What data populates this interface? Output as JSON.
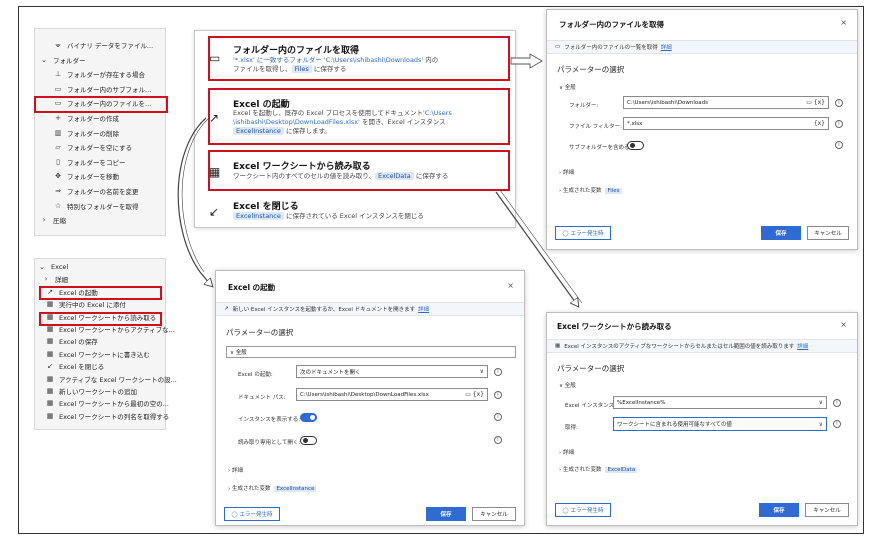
{
  "sidebar_top": {
    "items": [
      {
        "icon": "binary-icon",
        "glyph": "⩖",
        "label": "バイナリ データをファイル..."
      },
      {
        "icon": "chevron-down-icon",
        "glyph": "⌄",
        "label": "フォルダー"
      },
      {
        "icon": "folder-exists-icon",
        "glyph": "⊥",
        "label": "フォルダーが存在する場合"
      },
      {
        "icon": "subfolder-icon",
        "glyph": "▭",
        "label": "フォルダー内のサブフォル..."
      },
      {
        "icon": "folder-files-icon",
        "glyph": "▭",
        "label": "フォルダー内のファイルを..."
      },
      {
        "icon": "plus-icon",
        "glyph": "+",
        "label": "フォルダーの作成"
      },
      {
        "icon": "trash-icon",
        "glyph": "▥",
        "label": "フォルダーの削除"
      },
      {
        "icon": "folder-empty-icon",
        "glyph": "▱",
        "label": "フォルダーを空にする"
      },
      {
        "icon": "copy-icon",
        "glyph": "▯",
        "label": "フォルダーをコピー"
      },
      {
        "icon": "move-icon",
        "glyph": "✥",
        "label": "フォルダーを移動"
      },
      {
        "icon": "rename-icon",
        "glyph": "⇒",
        "label": "フォルダーの名前を変更"
      },
      {
        "icon": "star-icon",
        "glyph": "☆",
        "label": "特別なフォルダーを取得"
      },
      {
        "icon": "chevron-right-icon",
        "glyph": "›",
        "label": "圧縮"
      }
    ]
  },
  "sidebar_excel": {
    "items": [
      {
        "icon": "chevron-down-icon",
        "glyph": "⌄",
        "label": "Excel"
      },
      {
        "icon": "chevron-right-icon",
        "glyph": "›",
        "label": "詳細"
      },
      {
        "icon": "excel-launch-icon",
        "glyph": "↗",
        "label": "Excel の起動"
      },
      {
        "icon": "excel-icon",
        "glyph": "▦",
        "label": "実行中の Excel に添付"
      },
      {
        "icon": "excel-icon",
        "glyph": "▦",
        "label": "Excel ワークシートから読み取る"
      },
      {
        "icon": "excel-icon",
        "glyph": "▦",
        "label": "Excel ワークシートからアクティブな..."
      },
      {
        "icon": "excel-icon",
        "glyph": "▦",
        "label": "Excel の保存"
      },
      {
        "icon": "excel-icon",
        "glyph": "▦",
        "label": "Excel ワークシートに書き込む"
      },
      {
        "icon": "excel-close-icon",
        "glyph": "↙",
        "label": "Excel を閉じる"
      },
      {
        "icon": "excel-icon",
        "glyph": "▦",
        "label": "アクティブな Excel ワークシートの設..."
      },
      {
        "icon": "excel-icon",
        "glyph": "▦",
        "label": "新しいワークシートの追加"
      },
      {
        "icon": "excel-icon",
        "glyph": "▦",
        "label": "Excel ワークシートから最初の空の..."
      },
      {
        "icon": "excel-icon",
        "glyph": "▦",
        "label": "Excel ワークシートの列名を取得する"
      }
    ]
  },
  "flow": {
    "actions": [
      {
        "icon_glyph": "▭",
        "title": "フォルダー内のファイルを取得",
        "desc1_a": "'*.xlsx' に一致するフォルダー",
        "desc1_b": "'C:\\Users\\ishibashi\\Downloads'",
        "desc1_c": " 内の",
        "desc2_a": "ファイルを取得し、",
        "desc2_var": "Files",
        "desc2_b": " に保存する"
      },
      {
        "icon_glyph": "↗",
        "title": "Excel の起動",
        "desc1_a": "Excel を起動し、既存の Excel プロセスを使用してドキュメント",
        "desc1_b": "'C:\\Users",
        "desc2_a": "\\ishibashi\\Desktop\\DownLoadFiles.xlsx'",
        "desc2_b": " を開き、Excel インスタンス",
        "desc3_var": "ExcelInstance",
        "desc3_b": " に保存します。"
      },
      {
        "icon_glyph": "▦",
        "title": "Excel ワークシートから読み取る",
        "desc1_a": "ワークシート内のすべてのセルの値を読み取り、",
        "desc1_var": "ExcelData",
        "desc1_b": " に保存する"
      },
      {
        "icon_glyph": "↙",
        "title": "Excel を閉じる",
        "desc1_var": "ExcelInstance",
        "desc1_b": " に保存されている Excel インスタンスを閉じる"
      }
    ]
  },
  "dialog_folder": {
    "title": "フォルダー内のファイルを取得",
    "close": "×",
    "info": "フォルダー内のファイルの一覧を取得",
    "info_link": "詳細",
    "params_heading": "パラメーターの選択",
    "general": "∨ 全般",
    "folder_label": "フォルダー:",
    "folder_value": "C:\\Users\\ishibashi\\Downloads",
    "folder_icons": "▭ {x}",
    "filter_label": "ファイル フィルター:",
    "filter_value": "*.xlsx",
    "filter_icons": "{x}",
    "subfolder_label": "サブフォルダーを含める:",
    "details": "› 詳細",
    "generated": "› 生成された変数",
    "generated_var": "Files",
    "error_btn": "◯ エラー発生時",
    "save": "保存",
    "cancel": "キャンセル"
  },
  "dialog_excel": {
    "title": "Excel の起動",
    "close": "×",
    "info": "新しい Excel インスタンスを起動するか、Excel ドキュメントを開きます",
    "info_link": "詳細",
    "params_heading": "パラメーターの選択",
    "general": "∨ 全般",
    "launch_label": "Excel の起動:",
    "launch_value": "次のドキュメントを開く",
    "doc_label": "ドキュメント パス:",
    "doc_value": "C:\\Users\\ishibashi\\Desktop\\DownLoadFiles.xlsx",
    "doc_icons": "▭ {x}",
    "visible_label": "インスタンスを表示する:",
    "readonly_label": "読み取り専用として開く:",
    "details": "› 詳細",
    "generated": "› 生成された変数",
    "generated_var": "ExcelInstance",
    "error_btn": "◯ エラー発生時",
    "save": "保存",
    "cancel": "キャンセル",
    "chevron": "∨"
  },
  "dialog_read": {
    "title": "Excel ワークシートから読み取る",
    "close": "×",
    "info": "Excel インスタンスのアクティブなワークシートからセルまたはセル範囲の値を読み取ります",
    "info_link": "詳細",
    "params_heading": "パラメーターの選択",
    "general": "∨ 全般",
    "instance_label": "Excel インスタンス:",
    "instance_value": "%ExcelInstance%",
    "get_label": "取得:",
    "get_value": "ワークシートに含まれる使用可能なすべての値",
    "details": "› 詳細",
    "generated": "› 生成された変数",
    "generated_var": "ExcelData",
    "error_btn": "◯ エラー発生時",
    "save": "保存",
    "cancel": "キャンセル",
    "chevron": "∨"
  },
  "colors": {
    "highlight": "#d0101f",
    "accent": "#2f6bd3",
    "variable_chip": "#dbe8f8"
  }
}
